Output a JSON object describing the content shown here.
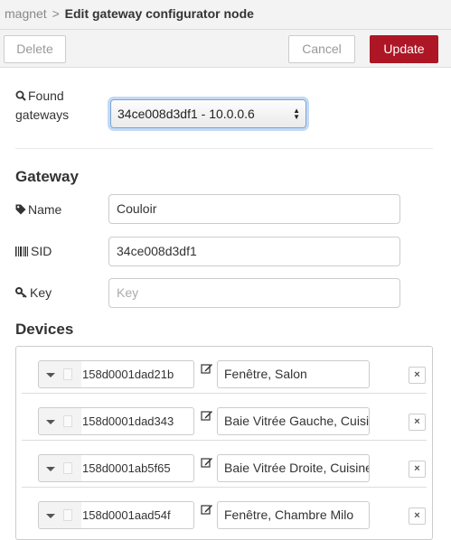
{
  "breadcrumb": {
    "parent": "magnet",
    "separator": ">",
    "current": "Edit gateway configurator node"
  },
  "toolbar": {
    "delete_label": "Delete",
    "cancel_label": "Cancel",
    "update_label": "Update"
  },
  "found": {
    "label_line1": "Found",
    "label_line2": "gateways",
    "selected": "34ce008d3df1 - 10.0.0.6"
  },
  "gateway": {
    "heading": "Gateway",
    "name_label": "Name",
    "name_value": "Couloir",
    "sid_label": "SID",
    "sid_value": "34ce008d3df1",
    "key_label": "Key",
    "key_value": "",
    "key_placeholder": "Key"
  },
  "devices": {
    "heading": "Devices",
    "remove_symbol": "×",
    "items": [
      {
        "sid": "158d0001dad21b",
        "name": "Fenêtre, Salon"
      },
      {
        "sid": "158d0001dad343",
        "name": "Baie Vitrée Gauche, Cuisine"
      },
      {
        "sid": "158d0001ab5f65",
        "name": "Baie Vitrée Droite, Cuisine"
      },
      {
        "sid": "158d0001aad54f",
        "name": "Fenêtre, Chambre Milo"
      }
    ]
  },
  "colors": {
    "primary_button": "#ad1625",
    "focus_ring": "#7aa5d6"
  }
}
